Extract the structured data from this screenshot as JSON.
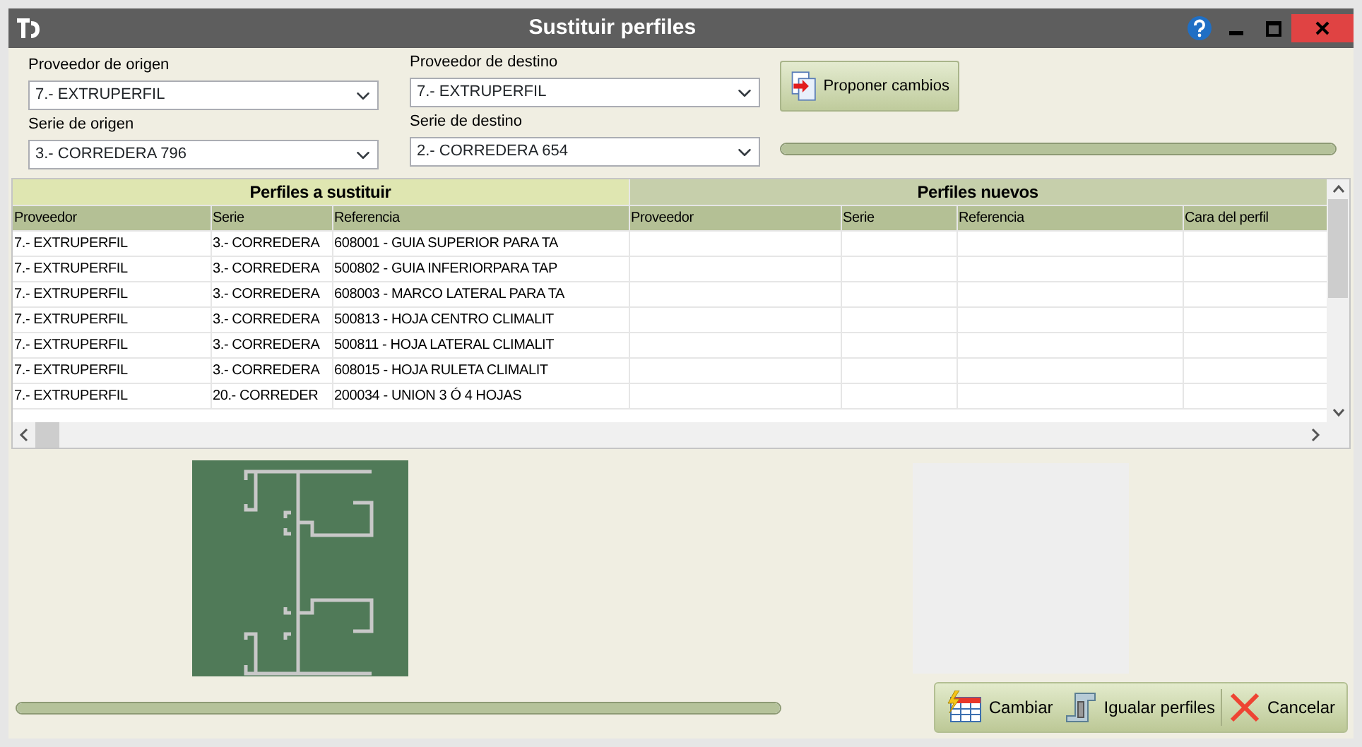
{
  "window": {
    "title": "Sustituir perfiles"
  },
  "filters": [
    {
      "label": "Proveedor de origen",
      "value": "7.- EXTRUPERFIL"
    },
    {
      "label": "Serie de origen",
      "value": "3.- CORREDERA 796"
    },
    {
      "label": "Proveedor de destino",
      "value": "7.- EXTRUPERFIL"
    },
    {
      "label": "Serie de destino",
      "value": "2.- CORREDERA 654"
    }
  ],
  "propose_button": "Proponer cambios",
  "progress": [
    {
      "level": 1
    },
    {
      "level": 1
    }
  ],
  "table": {
    "groups": [
      {
        "label": "Perfiles a sustituir"
      },
      {
        "label": "Perfiles nuevos"
      }
    ],
    "columns": [
      "Proveedor",
      "Serie",
      "Referencia",
      "Proveedor",
      "Serie",
      "Referencia",
      "Cara del perfil"
    ],
    "rows": [
      [
        "7.- EXTRUPERFIL",
        "3.- CORREDERA",
        "608001 - GUIA SUPERIOR PARA TA",
        "",
        "",
        "",
        ""
      ],
      [
        "7.- EXTRUPERFIL",
        "3.- CORREDERA",
        "500802 - GUIA INFERIORPARA TAP",
        "",
        "",
        "",
        ""
      ],
      [
        "7.- EXTRUPERFIL",
        "3.- CORREDERA",
        "608003 - MARCO LATERAL PARA TA",
        "",
        "",
        "",
        ""
      ],
      [
        "7.- EXTRUPERFIL",
        "3.- CORREDERA",
        "500813 - HOJA CENTRO CLIMALIT",
        "",
        "",
        "",
        ""
      ],
      [
        "7.- EXTRUPERFIL",
        "3.- CORREDERA",
        "500811 - HOJA LATERAL CLIMALIT",
        "",
        "",
        "",
        ""
      ],
      [
        "7.- EXTRUPERFIL",
        "3.- CORREDERA",
        "608015 - HOJA RULETA CLIMALIT",
        "",
        "",
        "",
        ""
      ],
      [
        "7.- EXTRUPERFIL",
        "20.- CORREDER",
        "200034 - UNION 3 Ó 4 HOJAS",
        "",
        "",
        "",
        ""
      ]
    ]
  },
  "buttons": [
    {
      "kind": "change",
      "label": "Cambiar"
    },
    {
      "kind": "match",
      "label": "Igualar perfiles"
    },
    {
      "kind": "cancel",
      "label": "Cancelar"
    }
  ]
}
